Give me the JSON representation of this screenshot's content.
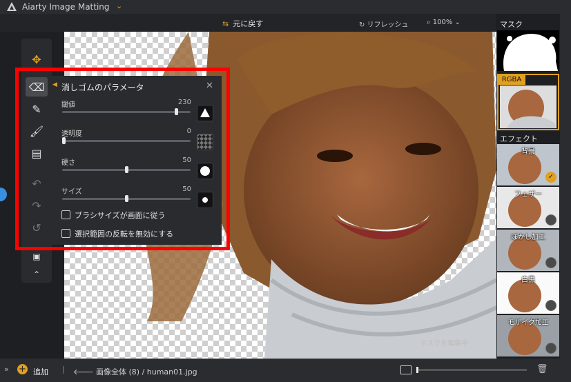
{
  "app": {
    "title": "Aiarty Image Matting"
  },
  "topbar": {
    "undo_label": "元に戻す",
    "refresh_label": "リフレッシュ",
    "zoom": "100%"
  },
  "panel": {
    "title": "消しゴムのパラメータ",
    "params": [
      {
        "label": "閾値",
        "value": "230",
        "fraction": 0.9
      },
      {
        "label": "透明度",
        "value": "0",
        "fraction": 0.0
      },
      {
        "label": "硬さ",
        "value": "50",
        "fraction": 0.5
      },
      {
        "label": "サイズ",
        "value": "50",
        "fraction": 0.5
      }
    ],
    "checkboxes": [
      {
        "label": "ブラシサイズが画面に従う",
        "checked": false
      },
      {
        "label": "選択範囲の反転を無効にする",
        "checked": false
      }
    ]
  },
  "canvas": {
    "watermark": "マスクを編集中"
  },
  "right": {
    "mask_label": "マスク",
    "rgba_label": "RGBA",
    "effect_label": "エフェクト",
    "effects": [
      {
        "label": "背景",
        "selected": true
      },
      {
        "label": "フェザー",
        "selected": false
      },
      {
        "label": "ぼかし加工",
        "selected": false
      },
      {
        "label": "白黒",
        "selected": false
      },
      {
        "label": "モザイク加工",
        "selected": false
      }
    ]
  },
  "bottom": {
    "add_label": "追加",
    "breadcrumb": "画像全体 (8)  /  human01.jpg"
  },
  "colors": {
    "accent": "#e0a020",
    "highlight": "#ff0000"
  }
}
